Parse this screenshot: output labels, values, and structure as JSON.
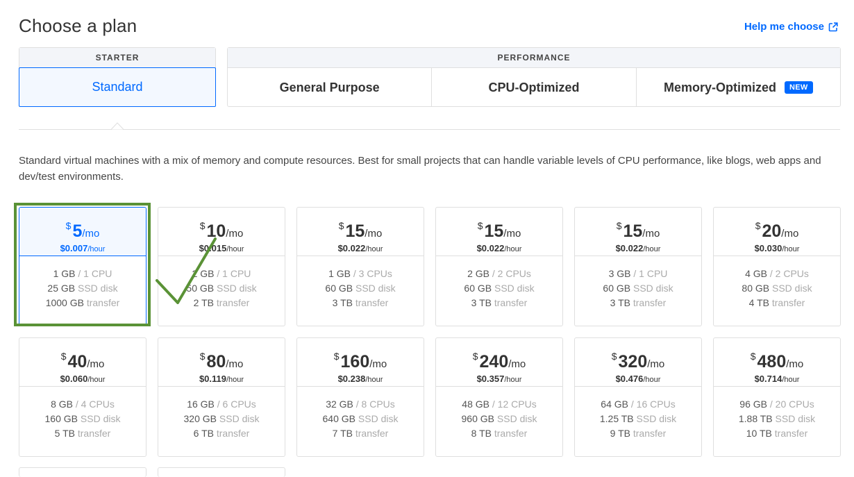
{
  "header": {
    "title": "Choose a plan",
    "help_label": "Help me choose"
  },
  "categories": {
    "starter": {
      "label": "STARTER",
      "tabs": [
        {
          "label": "Standard"
        }
      ]
    },
    "performance": {
      "label": "PERFORMANCE",
      "tabs": [
        {
          "label": "General Purpose"
        },
        {
          "label": "CPU-Optimized"
        },
        {
          "label": "Memory-Optimized",
          "badge": "NEW"
        }
      ]
    }
  },
  "description": "Standard virtual machines with a mix of memory and compute resources. Best for small projects that can handle variable levels of CPU performance, like blogs, web apps and dev/test environments.",
  "colors": {
    "accent": "#0069ff",
    "highlight": "#5a9236",
    "border": "#dfdfdf"
  },
  "currency": "$",
  "price_unit": "/mo",
  "hour_unit": "/hour",
  "spec_units": {
    "disk": "SSD disk",
    "transfer": "transfer"
  },
  "plans": [
    {
      "price": "5",
      "hourly": "$0.007",
      "memory": "1 GB",
      "cpu": "/ 1 CPU",
      "disk": "25 GB",
      "transfer": "1000 GB",
      "selected": true
    },
    {
      "price": "10",
      "hourly": "$0.015",
      "memory": "2 GB",
      "cpu": "/ 1 CPU",
      "disk": "50 GB",
      "transfer": "2 TB"
    },
    {
      "price": "15",
      "hourly": "$0.022",
      "memory": "1 GB",
      "cpu": "/ 3 CPUs",
      "disk": "60 GB",
      "transfer": "3 TB"
    },
    {
      "price": "15",
      "hourly": "$0.022",
      "memory": "2 GB",
      "cpu": "/ 2 CPUs",
      "disk": "60 GB",
      "transfer": "3 TB"
    },
    {
      "price": "15",
      "hourly": "$0.022",
      "memory": "3 GB",
      "cpu": "/ 1 CPU",
      "disk": "60 GB",
      "transfer": "3 TB"
    },
    {
      "price": "20",
      "hourly": "$0.030",
      "memory": "4 GB",
      "cpu": "/ 2 CPUs",
      "disk": "80 GB",
      "transfer": "4 TB"
    },
    {
      "price": "40",
      "hourly": "$0.060",
      "memory": "8 GB",
      "cpu": "/ 4 CPUs",
      "disk": "160 GB",
      "transfer": "5 TB"
    },
    {
      "price": "80",
      "hourly": "$0.119",
      "memory": "16 GB",
      "cpu": "/ 6 CPUs",
      "disk": "320 GB",
      "transfer": "6 TB"
    },
    {
      "price": "160",
      "hourly": "$0.238",
      "memory": "32 GB",
      "cpu": "/ 8 CPUs",
      "disk": "640 GB",
      "transfer": "7 TB"
    },
    {
      "price": "240",
      "hourly": "$0.357",
      "memory": "48 GB",
      "cpu": "/ 12 CPUs",
      "disk": "960 GB",
      "transfer": "8 TB"
    },
    {
      "price": "320",
      "hourly": "$0.476",
      "memory": "64 GB",
      "cpu": "/ 16 CPUs",
      "disk": "1.25 TB",
      "transfer": "9 TB"
    },
    {
      "price": "480",
      "hourly": "$0.714",
      "memory": "96 GB",
      "cpu": "/ 20 CPUs",
      "disk": "1.88 TB",
      "transfer": "10 TB"
    }
  ]
}
